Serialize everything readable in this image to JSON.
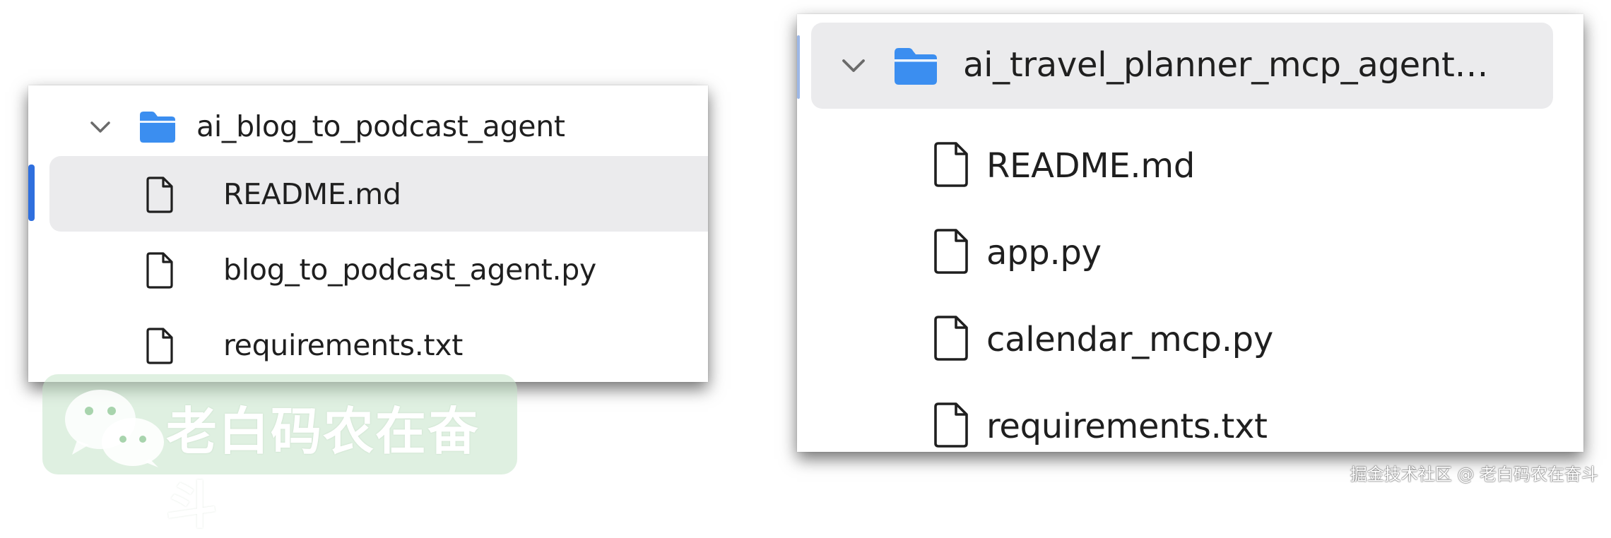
{
  "left_panel": {
    "folder": {
      "name": "ai_blog_to_podcast_agent",
      "expanded": true
    },
    "files": [
      {
        "name": "README.md",
        "selected": true
      },
      {
        "name": "blog_to_podcast_agent.py",
        "selected": false
      },
      {
        "name": "requirements.txt",
        "selected": false
      }
    ]
  },
  "right_panel": {
    "folder": {
      "name": "ai_travel_planner_mcp_agent…",
      "expanded": true,
      "selected": true
    },
    "files": [
      {
        "name": "README.md"
      },
      {
        "name": "app.py"
      },
      {
        "name": "calendar_mcp.py"
      },
      {
        "name": "requirements.txt"
      }
    ]
  },
  "watermark": {
    "brand": "老白码农在奋斗",
    "credit": "掘金技术社区 @ 老白码农在奋斗"
  },
  "colors": {
    "folder_icon": "#3b8ef0",
    "selection_bar": "#2f6fde",
    "selected_row_bg": "#ebebed",
    "watermark_badge": "#c4e4c8"
  },
  "icons": {
    "chevron": "chevron-down-icon",
    "folder": "folder-icon",
    "file": "file-icon",
    "brand": "wechat-icon"
  }
}
